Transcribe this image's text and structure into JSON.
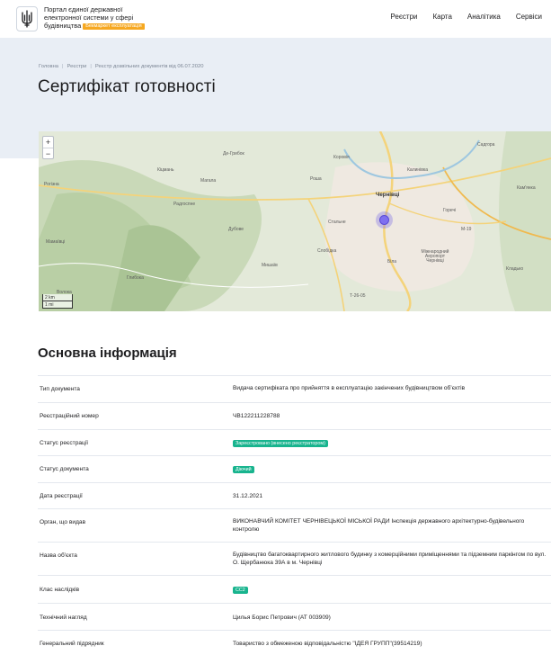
{
  "header": {
    "brand_line1": "Портал єдиної державної",
    "brand_line2": "електронної системи у сфері",
    "brand_line3": "будівництва",
    "brand_badge": "Бекмаркет експлуатація",
    "nav": [
      "Реєстри",
      "Карта",
      "Аналітика",
      "Сервіси"
    ]
  },
  "breadcrumb": [
    "Головна",
    "Реєстри",
    "Реєстр дозвільних документів від 06.07.2020"
  ],
  "page_title": "Сертифікат готовності",
  "map": {
    "zoom_in": "+",
    "zoom_out": "−",
    "scale_km": "2 km",
    "scale_mi": "1 mi",
    "labels": [
      "Де-Грибок",
      "Коровія",
      "Кіцмань",
      "Рогізна",
      "Мамаївці",
      "Чернівці",
      "Стальне",
      "Роша",
      "Садгора",
      "Магала",
      "Дубове",
      "Мишаїв",
      "Волока",
      "Слобідка",
      "Глибока",
      "Горечі",
      "Калинівка",
      "Біла",
      "Кам'янка",
      "Кладько",
      "Радгоспне",
      "Міжнародний Аеропорт Чернівці",
      "Т-26-05",
      "М-19"
    ],
    "accent_color": "#7f6ff0"
  },
  "section_title": "Основна інформація",
  "rows": [
    {
      "key": "Тип документа",
      "value": "Видача сертифіката про прийняття в експлуатацію закінчених будівництвом об’єктів"
    },
    {
      "key": "Реєстраційний номер",
      "value": "ЧВ122211228788"
    },
    {
      "key": "Статус реєстрації",
      "value": "Зареєстровано (внесено реєстратором)",
      "pill": true
    },
    {
      "key": "Статус документа",
      "value": "Діючий",
      "pill": true
    },
    {
      "key": "Дата реєстрації",
      "value": "31.12.2021"
    },
    {
      "key": "Орган, що видав",
      "value": "ВИКОНАВЧИЙ КОМІТЕТ ЧЕРНІВЕЦЬКОЇ МІСЬКОЇ РАДИ Інспекція державного архітектурно-будівельного контролю"
    },
    {
      "key": "Назва об'єкта",
      "value": "Будівництво багатоквартирного житлового будинку з комерційними приміщеннями та підземним паркінгом по вул. О. Щербанюка 39А в м. Чернівці"
    },
    {
      "key": "Клас наслідків",
      "value": "СС2",
      "pill": true
    },
    {
      "key": "Технічний нагляд",
      "value": "Цилья Борис Петрович (АТ 003909)"
    },
    {
      "key": "Генеральний підрядник",
      "value": "Товариство з обмеженою відповідальністю \"ІДЕЯ ГРУПП\"(39514219)"
    }
  ]
}
